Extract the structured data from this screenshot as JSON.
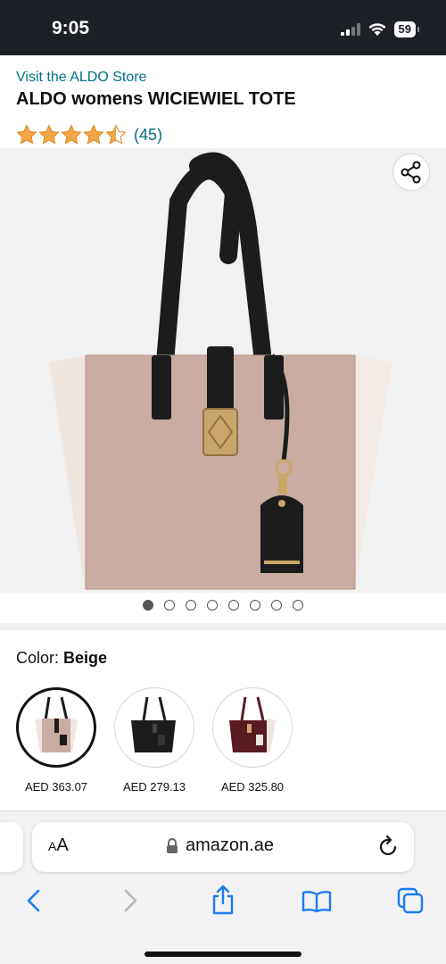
{
  "status_bar": {
    "time": "9:05",
    "battery": "59"
  },
  "product": {
    "store_link": "Visit the ALDO Store",
    "title": "ALDO womens WICIEWIEL TOTE",
    "rating_value": 4.5,
    "rating_count": "(45)"
  },
  "gallery": {
    "image_count": 8,
    "active_index": 0
  },
  "color": {
    "label": "Color: ",
    "selected": "Beige"
  },
  "swatches": [
    {
      "price": "AED 363.07",
      "color_name": "beige",
      "selected": true
    },
    {
      "price": "AED 279.13",
      "color_name": "black",
      "selected": false
    },
    {
      "price": "AED 325.80",
      "color_name": "burgundy",
      "selected": false
    }
  ],
  "browser": {
    "aa_label_small": "A",
    "aa_label_large": "A",
    "url": "amazon.ae"
  },
  "colors": {
    "link": "#007185",
    "star": "#f3a847",
    "ios_blue": "#1a7cf2",
    "bag_taupe": "#c9ada2",
    "bag_cream": "#efe5df",
    "bag_black": "#1c1c1c"
  }
}
